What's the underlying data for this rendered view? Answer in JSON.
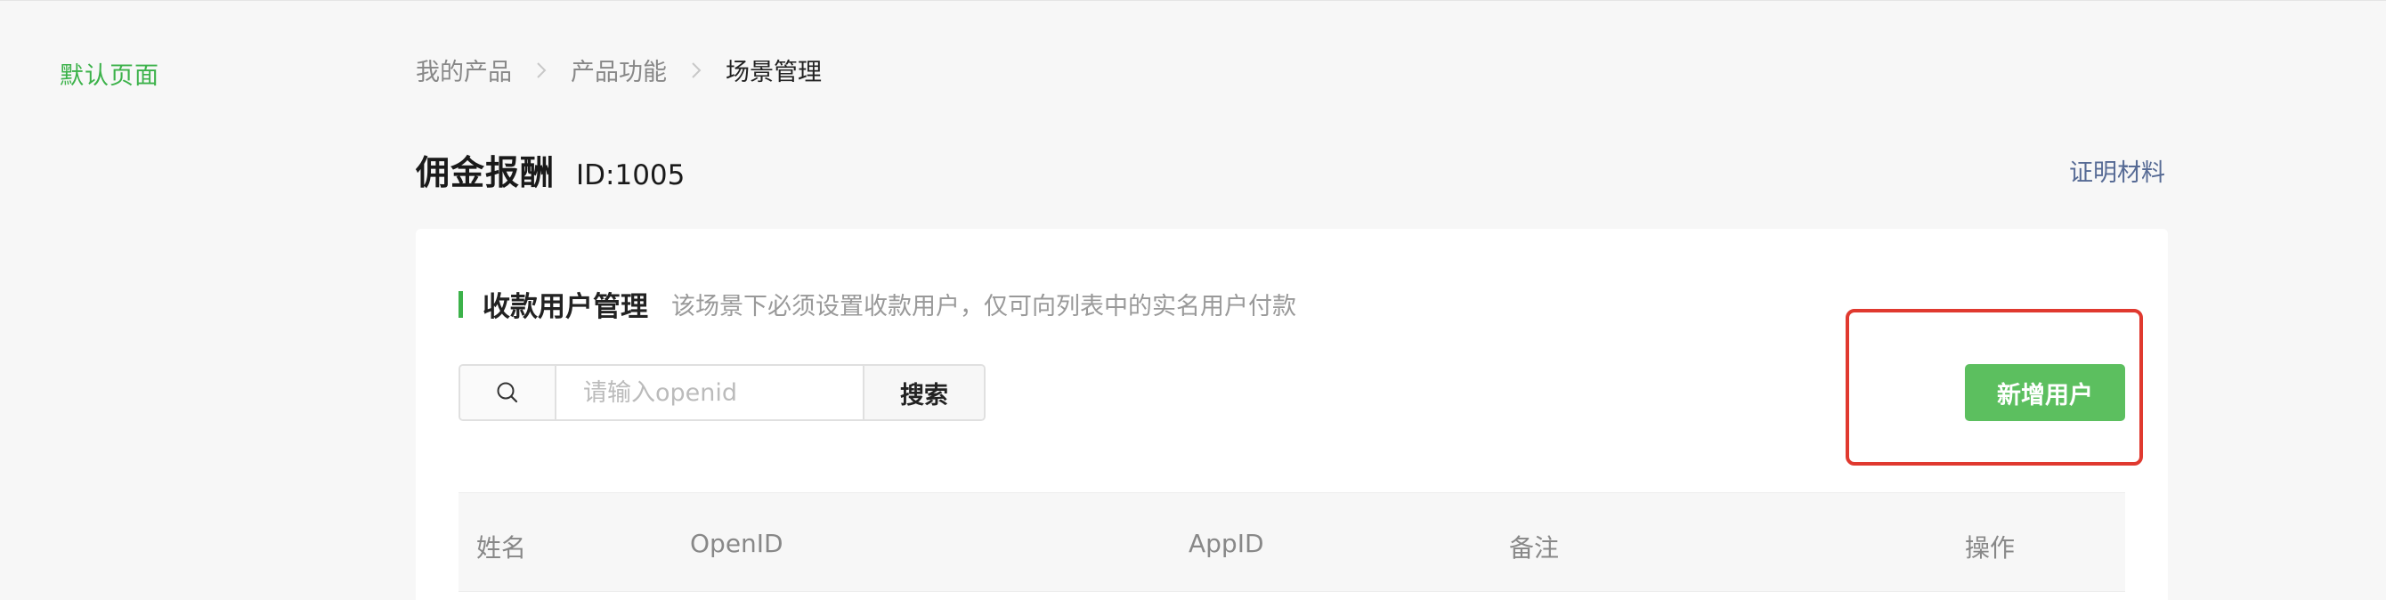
{
  "sidebar": {
    "items": [
      {
        "label": "默认页面",
        "active": true
      }
    ]
  },
  "breadcrumb": [
    {
      "label": "我的产品"
    },
    {
      "label": "产品功能"
    },
    {
      "label": "场景管理"
    }
  ],
  "header": {
    "title": "佣金报酬",
    "id_text": "ID:1005",
    "proof_link": "证明材料"
  },
  "section": {
    "title": "收款用户管理",
    "description": "该场景下必须设置收款用户，仅可向列表中的实名用户付款"
  },
  "search": {
    "icon": "search-icon",
    "placeholder": "请输入openid",
    "value": "",
    "button_label": "搜索"
  },
  "actions": {
    "add_user_label": "新增用户"
  },
  "table": {
    "columns": [
      "姓名",
      "OpenID",
      "AppID",
      "备注",
      "操作"
    ],
    "rows": []
  },
  "colors": {
    "accent": "#3cb24a",
    "primary_button": "#5cbf5f",
    "link": "#576b95",
    "highlight": "#e0392f"
  }
}
